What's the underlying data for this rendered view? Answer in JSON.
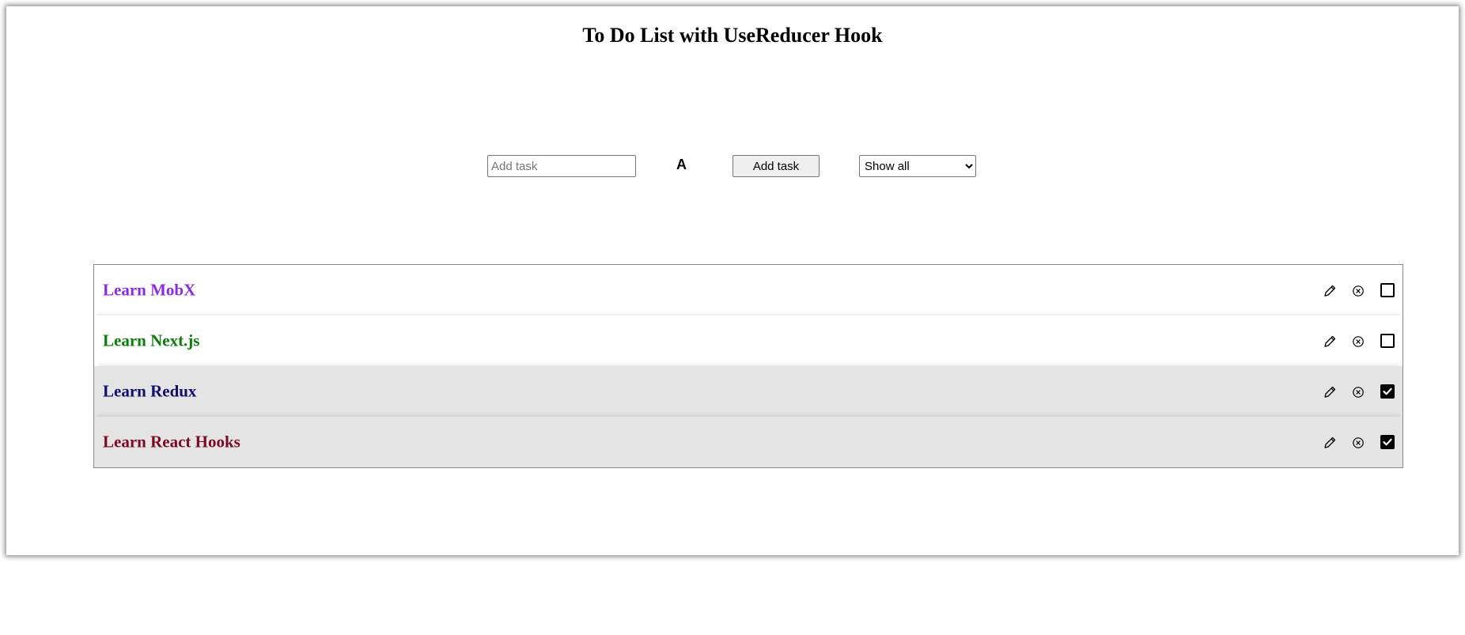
{
  "header": {
    "title": "To Do List with UseReducer Hook"
  },
  "controls": {
    "task_input_value": "",
    "task_input_placeholder": "Add task",
    "color_picker_label": "A",
    "add_button_label": "Add task",
    "filter_selected": "Show all"
  },
  "tasks": [
    {
      "text": "Learn MobX",
      "color": "#8a2be2",
      "completed": false
    },
    {
      "text": "Learn Next.js",
      "color": "#0b7d0b",
      "completed": false
    },
    {
      "text": "Learn Redux",
      "color": "#0f0f6e",
      "completed": true
    },
    {
      "text": "Learn React Hooks",
      "color": "#7d0a23",
      "completed": true
    }
  ],
  "icons": {
    "edit": "pencil-icon",
    "delete": "close-circle-icon",
    "complete": "checkbox-icon"
  }
}
